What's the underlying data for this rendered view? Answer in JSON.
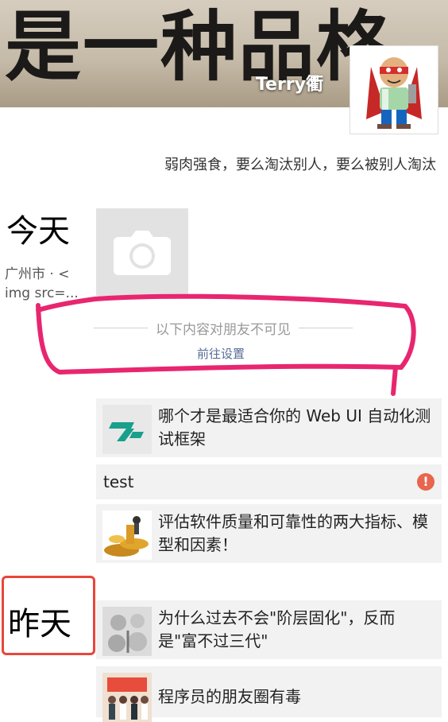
{
  "header": {
    "cover_text": "是一种品格",
    "username": "Terry衢",
    "signature": "弱肉强食，要么淘汰别人，要么被别人淘汰"
  },
  "today": {
    "label": "今天",
    "location_line1": "广州市 · <",
    "location_line2": "img src=..."
  },
  "privacy": {
    "hidden_text": "以下内容对朋友不可见",
    "settings_link": "前往设置"
  },
  "posts": [
    {
      "text": "哪个才是最适合你的 Web UI 自动化测试框架",
      "thumb": "testing-logo-icon"
    },
    {
      "text": "test",
      "status": "!",
      "status_color": "#e8654e"
    },
    {
      "text": "评估软件质量和可靠性的两大指标、模型和因素！",
      "thumb": "gold-coins-image"
    }
  ],
  "yesterday": {
    "label": "昨天",
    "posts": [
      {
        "text": "为什么过去不会\"阶层固化\"，反而是\"富不过三代\"",
        "thumb": "money-bags-image"
      },
      {
        "text": "程序员的朋友圈有毒",
        "thumb": "group-photo-image"
      }
    ]
  },
  "colors": {
    "link": "#576b95",
    "annotation_pink": "#e8266f",
    "highlight_red": "#e8463a"
  }
}
